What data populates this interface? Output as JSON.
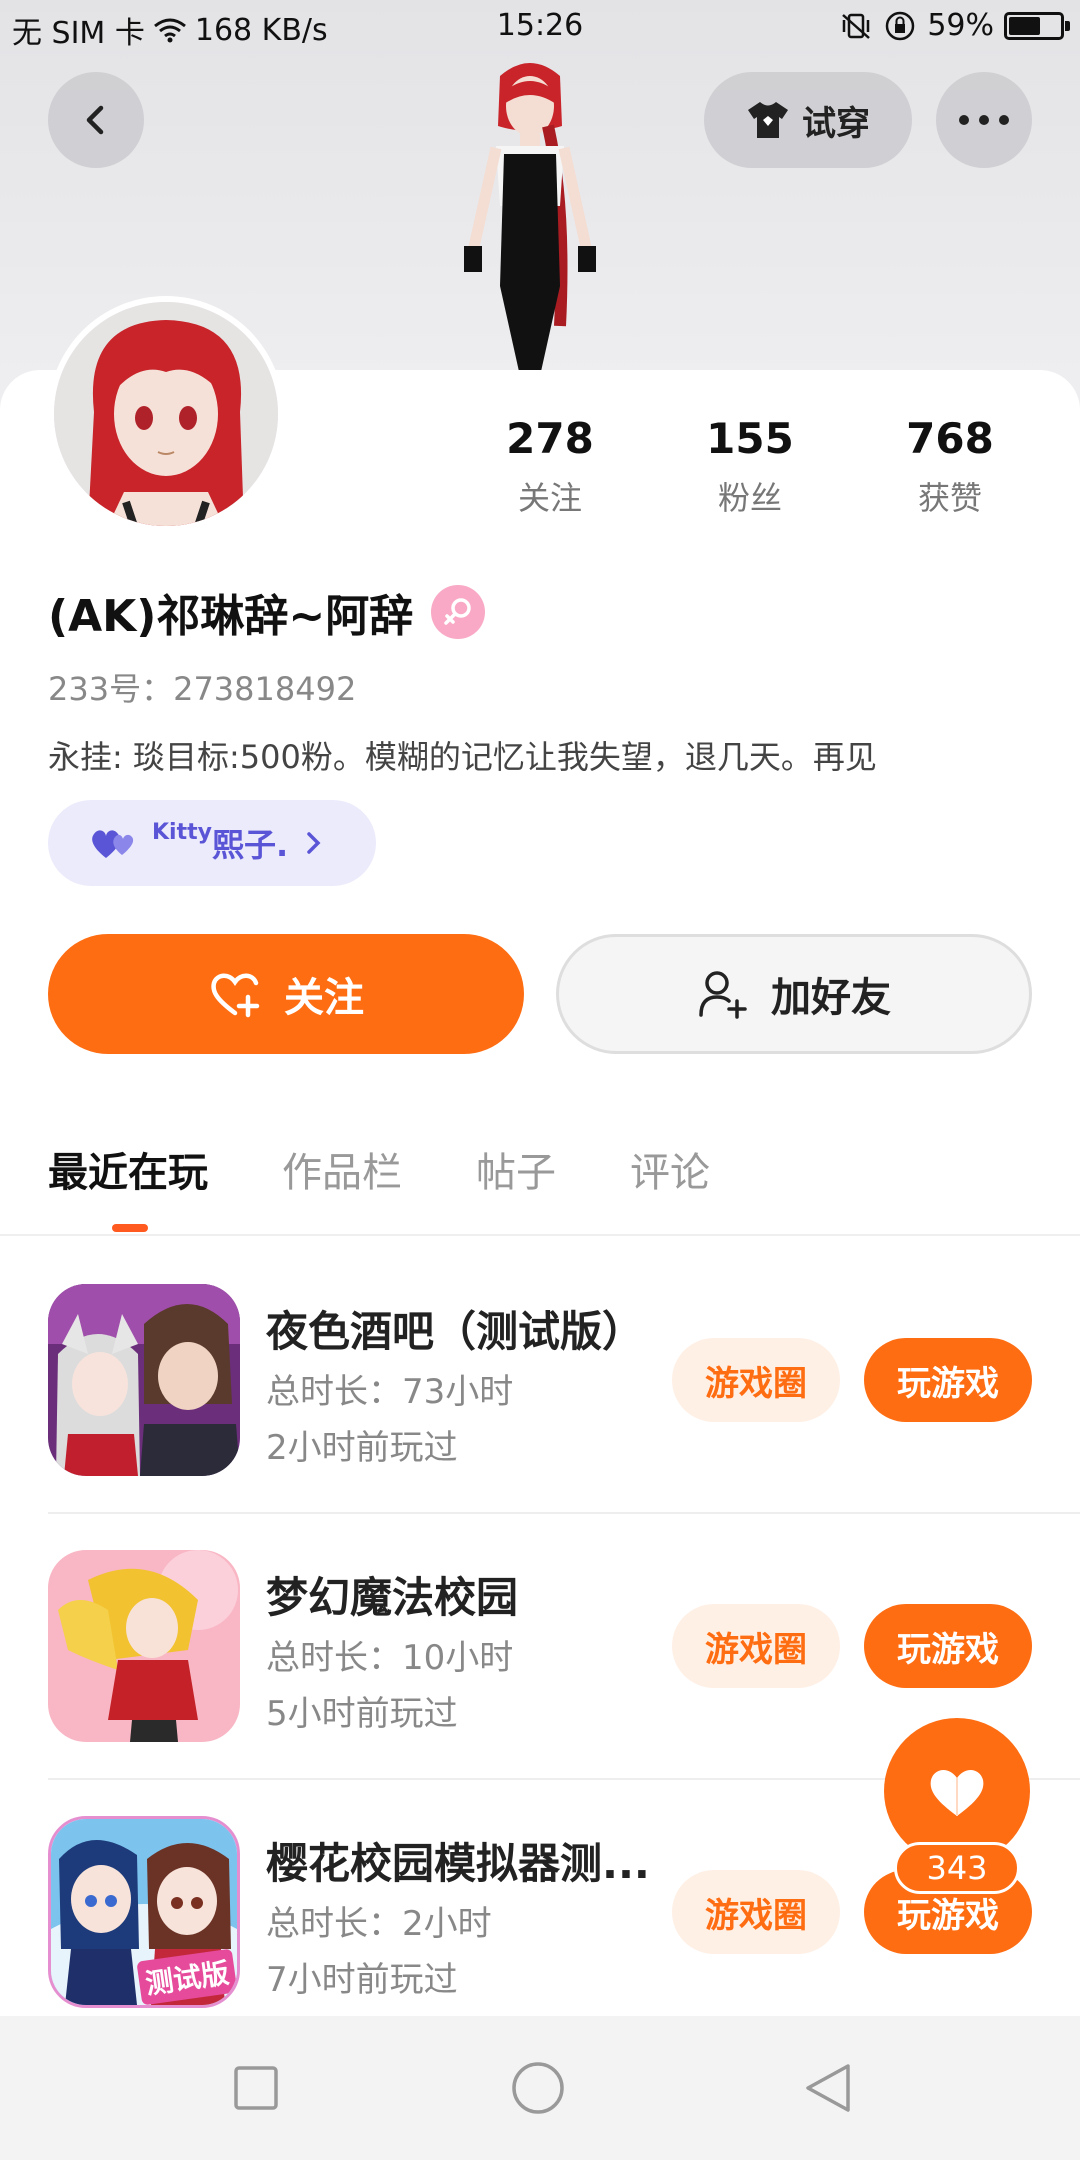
{
  "status_bar": {
    "carrier": "无 SIM 卡",
    "speed": "168 KB/s",
    "time": "15:26",
    "battery": "59%",
    "battery_level": 0.59
  },
  "header": {
    "back_icon": "chevron-left-icon",
    "tryon_label": "试穿",
    "more_icon": "more-dots-icon"
  },
  "profile": {
    "stats": [
      {
        "value": "278",
        "label": "关注"
      },
      {
        "value": "155",
        "label": "粉丝"
      },
      {
        "value": "768",
        "label": "获赞"
      }
    ],
    "username": "(AK)祁琳辞~阿辞",
    "gender_icon": "female-icon",
    "uid": "233号：273818492",
    "bio": "永挂: 琰目标:500粉。模糊的记忆让我失望，退几天。再见",
    "cp_badge": {
      "prefix": "Kitty",
      "name": "熙子."
    }
  },
  "actions": {
    "follow_label": "关注",
    "add_friend_label": "加好友"
  },
  "tabs": [
    {
      "label": "最近在玩",
      "active": true
    },
    {
      "label": "作品栏",
      "active": false
    },
    {
      "label": "帖子",
      "active": false
    },
    {
      "label": "评论",
      "active": false
    }
  ],
  "games": [
    {
      "title": "夜色酒吧（测试版）",
      "duration": "总时长：73小时",
      "last_played": "2小时前玩过",
      "circle_label": "游戏圈",
      "play_label": "玩游戏"
    },
    {
      "title": "梦幻魔法校园",
      "duration": "总时长：10小时",
      "last_played": "5小时前玩过",
      "circle_label": "游戏圈",
      "play_label": "玩游戏"
    },
    {
      "title": "樱花校园模拟器测...",
      "duration": "总时长：2小时",
      "last_played": "7小时前玩过",
      "circle_label": "游戏圈",
      "play_label": "玩游戏",
      "icon_tag": "测试版"
    }
  ],
  "fab": {
    "count": "343",
    "icon": "heart-icon"
  },
  "colors": {
    "accent": "#ff6d12",
    "accent_light": "#fff0e6",
    "cp": "#5a55d6"
  }
}
